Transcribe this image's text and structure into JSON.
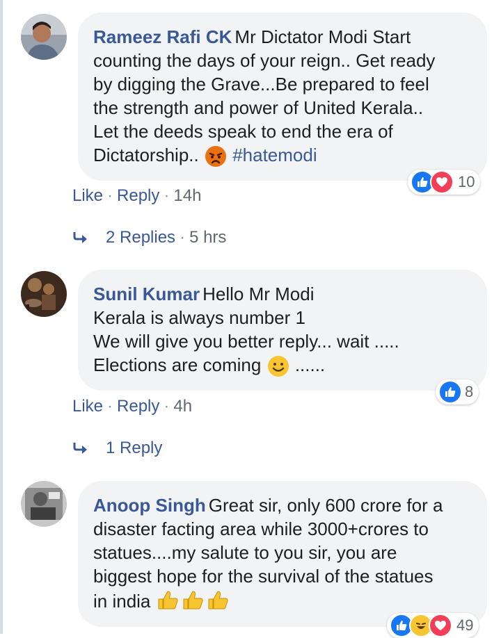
{
  "comments": [
    {
      "author": "Rameez Rafi CK",
      "lines": [
        "Mr Dictator Modi Start",
        "counting the days of your reign.. Get ready",
        "by digging the Grave...Be prepared to feel",
        "the strength and power of United Kerala..",
        "Let the deeds speak to end the era of",
        "Dictatorship.."
      ],
      "hashtag": "#hatemodi",
      "reaction_count": "10",
      "like_label": "Like",
      "reply_label": "Reply",
      "time": "14h",
      "replies_label": "2 Replies",
      "replies_time": "5 hrs"
    },
    {
      "author": "Sunil Kumar",
      "lines": [
        "Hello Mr Modi",
        "Kerala is always number 1",
        "We will give you better reply... wait .....",
        "Elections are coming",
        "......"
      ],
      "reaction_count": "8",
      "like_label": "Like",
      "reply_label": "Reply",
      "time": "4h",
      "replies_label": "1 Reply"
    },
    {
      "author": "Anoop Singh",
      "lines": [
        "Great sir, only 600 crore for a",
        "disaster facting area while 3000+crores to",
        "statues....my salute to you sir, you are",
        "biggest hope for the survival of the statues",
        "in india"
      ],
      "reaction_count": "49"
    }
  ],
  "separator": "·",
  "colors": {
    "link": "#385898",
    "bubble": "#f2f3f5",
    "like_blue": "#1877f2",
    "love_red": "#f33e58",
    "emoji_yellow": "#f7c531",
    "angry_orange": "#e9710f"
  }
}
